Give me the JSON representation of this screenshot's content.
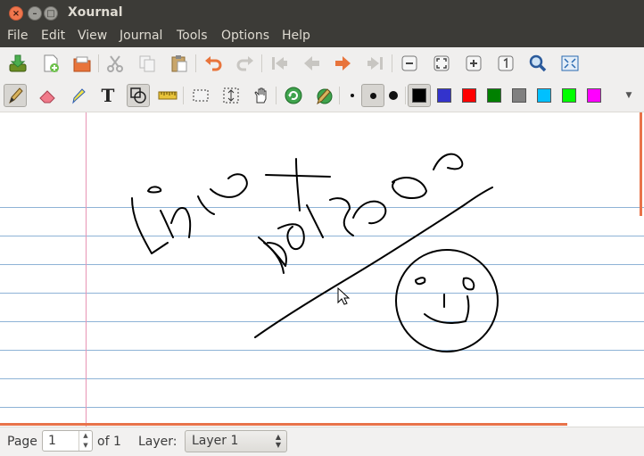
{
  "window": {
    "title": "Xournal"
  },
  "menu": [
    "File",
    "Edit",
    "View",
    "Journal",
    "Tools",
    "Options",
    "Help"
  ],
  "toolbar_top": [
    "save-icon",
    "new-page-icon",
    "open-icon",
    "cut-icon",
    "copy-icon",
    "paste-icon",
    "undo-icon",
    "redo-icon",
    "first-page-icon",
    "previous-page-icon",
    "next-page-icon",
    "last-page-icon",
    "zoom-out-icon",
    "zoom-fit-icon",
    "zoom-in-icon",
    "zoom-100-icon",
    "zoom-set-icon",
    "fullscreen-icon"
  ],
  "toolbar_bottom": {
    "tools": [
      "pen-icon",
      "eraser-icon",
      "highlighter-icon",
      "text-icon",
      "shape-recognizer-icon",
      "ruler-icon",
      "select-rectangle-icon",
      "vertical-space-icon",
      "hand-icon",
      "default-tool-icon",
      "default-pen-icon"
    ],
    "text_tool_label": "T",
    "active_tool": "pen",
    "pen_sizes": [
      "fine",
      "medium",
      "thick"
    ],
    "active_size": "medium",
    "colors": [
      "#000000",
      "#3333cc",
      "#ff0000",
      "#008000",
      "#808080",
      "#00c0ff",
      "#00ff00",
      "#ff00ff"
    ],
    "active_color": "#000000"
  },
  "status": {
    "page_label": "Page",
    "page_value": "1",
    "of_label": "of 1",
    "layer_label": "Layer:",
    "layer_value": "Layer 1"
  }
}
